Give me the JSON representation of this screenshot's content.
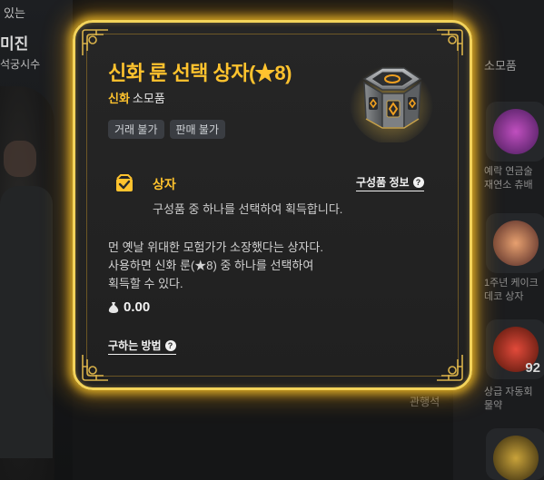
{
  "background": {
    "left_texts": [
      "있는",
      "미진",
      "석궁시수"
    ],
    "right_tab": "소모품",
    "bottom_label": "관행석",
    "shop_items": [
      {
        "caption": [
          "예락 연금술",
          "재연소 츄배"
        ],
        "count": ""
      },
      {
        "caption": [
          "1주년 케이크",
          "데코 상자"
        ],
        "count": ""
      },
      {
        "caption": [
          "상급 자동회",
          "물약"
        ],
        "count": "92"
      }
    ]
  },
  "tooltip": {
    "title": "신화 룬 선택 상자(★8)",
    "grade": "신화",
    "item_type": "소모품",
    "tags": [
      "거래 불가",
      "판매 불가"
    ],
    "section": {
      "icon": "box-check-icon",
      "title": "상자",
      "link": "구성품 정보",
      "description": "구성품 중 하나를 선택하여 획득합니다."
    },
    "flavor_lines": [
      "먼 옛날 위대한 모험가가 소장했다는 상자다.",
      "사용하면 신화 룬(★8) 중 하나를 선택하여",
      "획득할 수 있다."
    ],
    "price": "0.00",
    "how_to_get": "구하는 방법",
    "colors": {
      "accent": "#ffc32e",
      "border_glow": "#f3d35a"
    }
  }
}
